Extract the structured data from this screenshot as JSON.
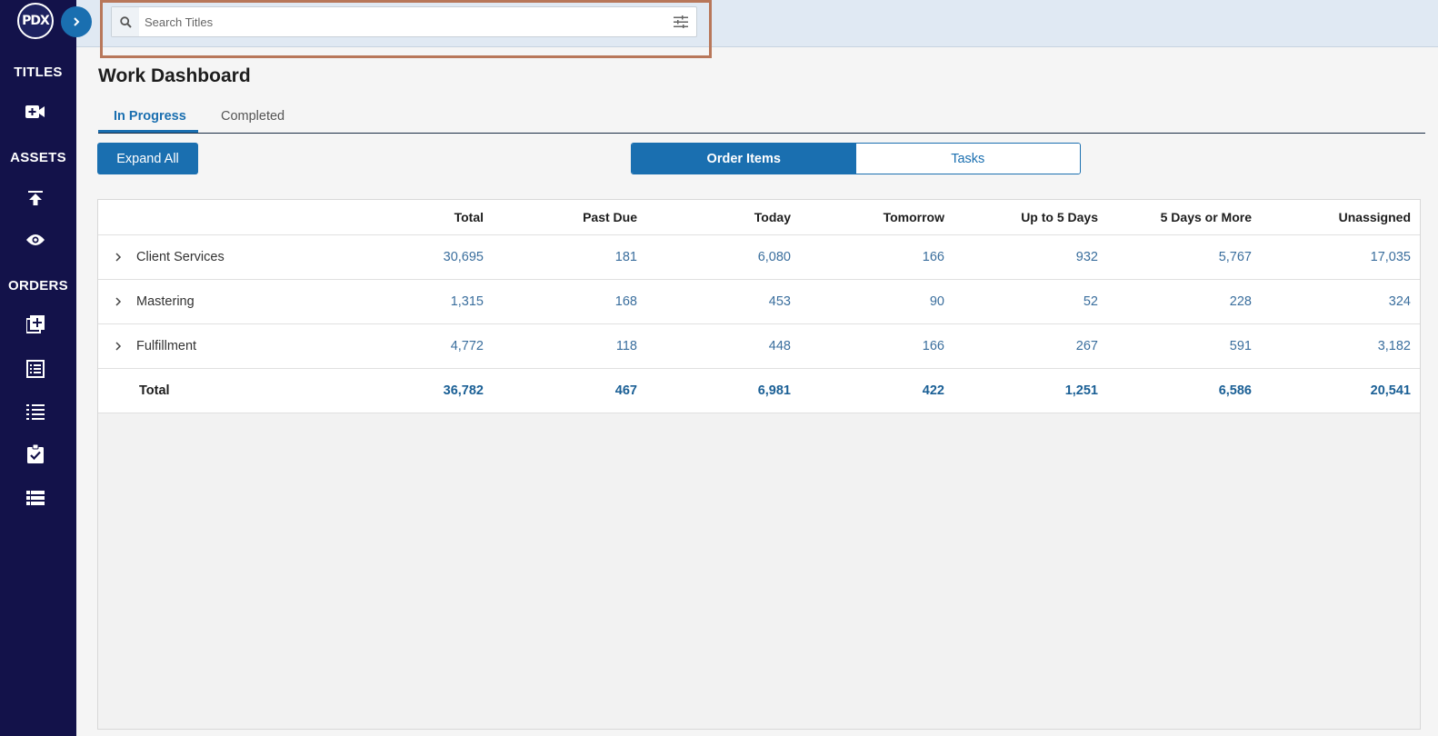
{
  "logo": "PDX",
  "sidebar": {
    "sections": [
      {
        "label": "TITLES"
      },
      {
        "label": "ASSETS"
      },
      {
        "label": "ORDERS"
      }
    ]
  },
  "search": {
    "placeholder": "Search Titles",
    "value": ""
  },
  "page": {
    "title": "Work Dashboard"
  },
  "tabs": [
    {
      "label": "In Progress",
      "active": true
    },
    {
      "label": "Completed",
      "active": false
    }
  ],
  "toolbar": {
    "expand_all": "Expand All"
  },
  "toggle": [
    {
      "label": "Order Items",
      "selected": true
    },
    {
      "label": "Tasks",
      "selected": false
    }
  ],
  "table": {
    "columns": [
      "",
      "Total",
      "Past Due",
      "Today",
      "Tomorrow",
      "Up to 5 Days",
      "5 Days or More",
      "Unassigned"
    ],
    "rows": [
      {
        "name": "Client Services",
        "values": [
          "30,695",
          "181",
          "6,080",
          "166",
          "932",
          "5,767",
          "17,035"
        ]
      },
      {
        "name": "Mastering",
        "values": [
          "1,315",
          "168",
          "453",
          "90",
          "52",
          "228",
          "324"
        ]
      },
      {
        "name": "Fulfillment",
        "values": [
          "4,772",
          "118",
          "448",
          "166",
          "267",
          "591",
          "3,182"
        ]
      }
    ],
    "total": {
      "name": "Total",
      "values": [
        "36,782",
        "467",
        "6,981",
        "422",
        "1,251",
        "6,586",
        "20,541"
      ]
    }
  },
  "colors": {
    "sidebar": "#13124a",
    "accent": "#1a6fb0",
    "highlight": "#b8775a"
  }
}
